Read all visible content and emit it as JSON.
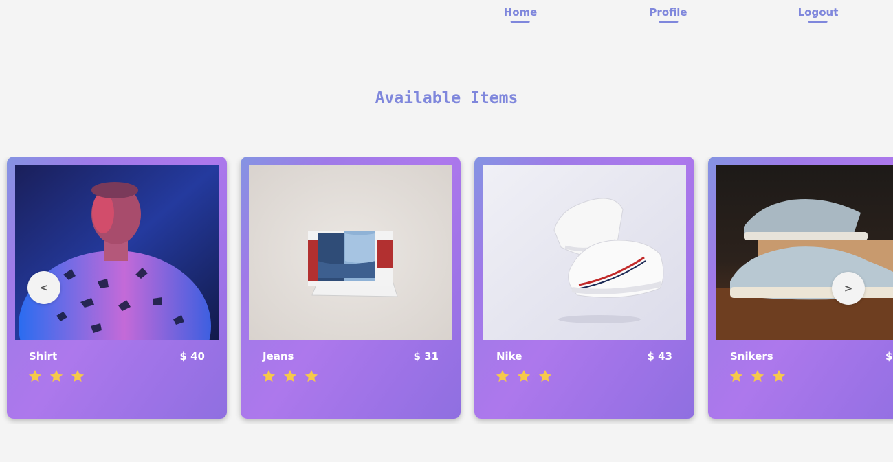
{
  "nav": {
    "items": [
      {
        "label": "Home"
      },
      {
        "label": "Profile"
      },
      {
        "label": "Logout"
      }
    ],
    "color": "#7f87dc"
  },
  "page": {
    "title": "Available Items"
  },
  "carousel": {
    "prev_label": "<",
    "next_label": ">",
    "items": [
      {
        "name": "Shirt",
        "price": "$ 40",
        "rating": 3
      },
      {
        "name": "Jeans",
        "price": "$ 31",
        "rating": 3
      },
      {
        "name": "Nike",
        "price": "$ 43",
        "rating": 3
      },
      {
        "name": "Snikers",
        "price": "$",
        "rating": 3
      }
    ]
  },
  "colors": {
    "accent": "#7f87dc",
    "card_gradient_start": "#8494e2",
    "card_gradient_end": "#ad78ec",
    "star": "#f6c94a",
    "background": "#f4f4f4"
  }
}
